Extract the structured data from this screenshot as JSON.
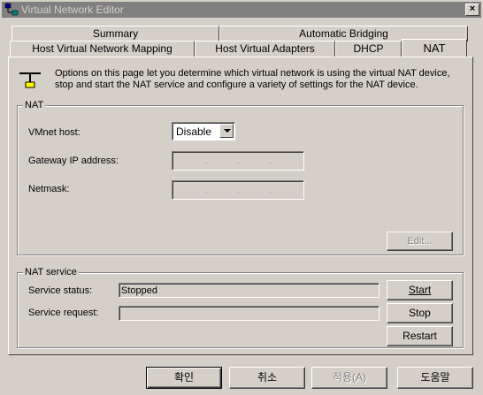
{
  "window": {
    "title": "Virtual Network Editor",
    "close_label": "×"
  },
  "tabs": {
    "row_back": [
      "Summary",
      "Automatic Bridging"
    ],
    "row_front": [
      "Host Virtual Network Mapping",
      "Host Virtual Adapters",
      "DHCP",
      "NAT"
    ],
    "active": "NAT"
  },
  "info": {
    "text": "Options on this page let you determine which virtual network is using the virtual NAT device, stop and start the NAT service and configure a variety of settings for the NAT device."
  },
  "nat_group": {
    "title": "NAT",
    "vmnet_host_label": "VMnet host:",
    "vmnet_host_value": "Disable",
    "gateway_label": "Gateway IP address:",
    "netmask_label": "Netmask:",
    "edit_label": "Edit..."
  },
  "service_group": {
    "title": "NAT service",
    "status_label": "Service status:",
    "status_value": "Stopped",
    "request_label": "Service request:",
    "request_value": "",
    "start_label": "Start",
    "stop_label": "Stop",
    "restart_label": "Restart"
  },
  "dialog_buttons": {
    "ok": "확인",
    "cancel": "취소",
    "apply": "적용(A)",
    "help": "도움말"
  }
}
